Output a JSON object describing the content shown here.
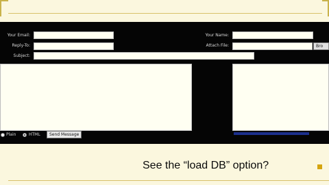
{
  "form": {
    "your_email_label": "Your Email:",
    "reply_to_label": "Reply-To:",
    "subject_label": "Subject:",
    "your_name_label": "Your Name:",
    "attach_file_label": "Attach File:",
    "browse_label": "Bro",
    "format_options": [
      {
        "label": "Plain",
        "checked": false
      },
      {
        "label": "HTML",
        "checked": true
      }
    ],
    "send_button_label": "Send Message"
  },
  "caption": "See the “load DB” option?",
  "colors": {
    "background": "#fbf7de",
    "panel": "#050505",
    "accent": "#d5a50f",
    "link": "#1b2f8c"
  }
}
